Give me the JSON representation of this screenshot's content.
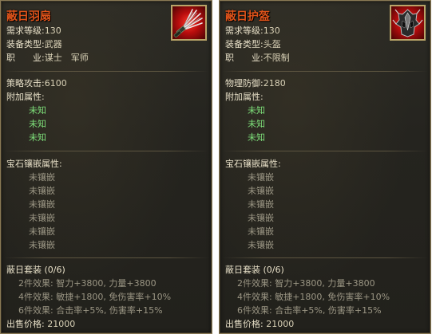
{
  "cards": [
    {
      "name": "蔽日羽扇",
      "icon": "fan-weapon-icon",
      "level_label": "需求等级",
      "level": "130",
      "type_label": "装备类型",
      "type": "武器",
      "job_label": "职　　业",
      "job": "谋士　军师",
      "stat_label": "策略攻击",
      "stat": "6100",
      "extra_label": "附加属性",
      "extras": [
        "未知",
        "未知",
        "未知"
      ],
      "gem_label": "宝石镶嵌属性",
      "gems": [
        "未镶嵌",
        "未镶嵌",
        "未镶嵌",
        "未镶嵌",
        "未镶嵌",
        "未镶嵌"
      ],
      "set_name": "蔽日套装 (0/6)",
      "set_effects": [
        {
          "label": "2件效果",
          "value": "智力+3800, 力量+3800"
        },
        {
          "label": "4件效果",
          "value": "敏捷+1800, 免伤害率+10%"
        },
        {
          "label": "6件效果",
          "value": "合击率+5%, 伤害率+15%"
        }
      ],
      "price_label": "出售价格",
      "price": "21000"
    },
    {
      "name": "蔽日护盔",
      "icon": "helmet-icon",
      "level_label": "需求等级",
      "level": "130",
      "type_label": "装备类型",
      "type": "头盔",
      "job_label": "职　　业",
      "job": "不限制",
      "stat_label": "物理防御",
      "stat": "2180",
      "extra_label": "附加属性",
      "extras": [
        "未知",
        "未知",
        "未知"
      ],
      "gem_label": "宝石镶嵌属性",
      "gems": [
        "未镶嵌",
        "未镶嵌",
        "未镶嵌",
        "未镶嵌",
        "未镶嵌",
        "未镶嵌"
      ],
      "set_name": "蔽日套装 (0/6)",
      "set_effects": [
        {
          "label": "2件效果",
          "value": "智力+3800, 力量+3800"
        },
        {
          "label": "4件效果",
          "value": "敏捷+1800, 免伤害率+10%"
        },
        {
          "label": "6件效果",
          "value": "合击率+5%, 伤害率+15%"
        }
      ],
      "price_label": "出售价格",
      "price": "21000"
    }
  ],
  "colors": {
    "title": "#e0531a",
    "unknown": "#7ee07a",
    "muted": "#9b9684",
    "text": "#e8e0c8"
  }
}
